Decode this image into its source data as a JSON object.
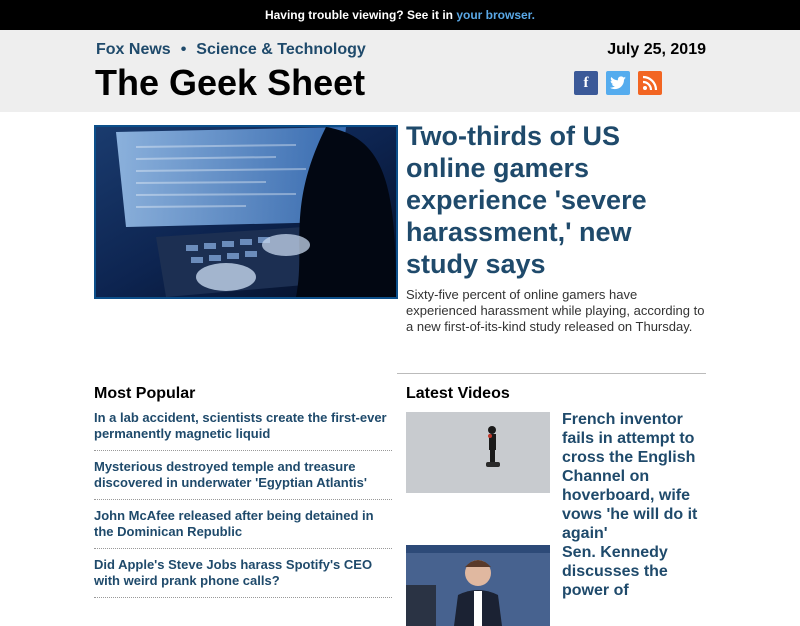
{
  "topbar": {
    "text": "Having trouble viewing? See it in ",
    "link": "your browser."
  },
  "header": {
    "crumb1": "Fox News",
    "crumb_sep": "•",
    "crumb2": "Science & Technology",
    "date": "July 25, 2019",
    "title": "The Geek Sheet",
    "social": [
      {
        "icon": "facebook-icon",
        "glyph": "f"
      },
      {
        "icon": "twitter-icon",
        "glyph": "t"
      },
      {
        "icon": "rss-icon",
        "glyph": "◉"
      }
    ]
  },
  "hero": {
    "title": "Two-thirds of US online gamers experience 'severe harassment,' new study says",
    "summary": "Sixty-five percent of online gamers have experienced harassment while playing, according to a new first-of-its-kind study released on Thursday."
  },
  "most_popular": {
    "heading": "Most Popular",
    "items": [
      "In a lab accident, scientists create the first-ever permanently magnetic liquid",
      "Mysterious destroyed temple and treasure discovered in underwater 'Egyptian Atlantis'",
      "John McAfee released after being detained in the Dominican Republic",
      "Did Apple's Steve Jobs harass Spotify's CEO with weird prank phone calls?"
    ]
  },
  "latest_videos": {
    "heading": "Latest Videos",
    "items": [
      "French inventor fails in attempt to cross the English Channel on hoverboard, wife vows 'he will do it again'",
      "Sen. Kennedy discusses the power of"
    ]
  },
  "colors": {
    "link": "#1f4a6b",
    "topbar_link": "#5aa8e6",
    "header_bg": "#eeeeee"
  }
}
